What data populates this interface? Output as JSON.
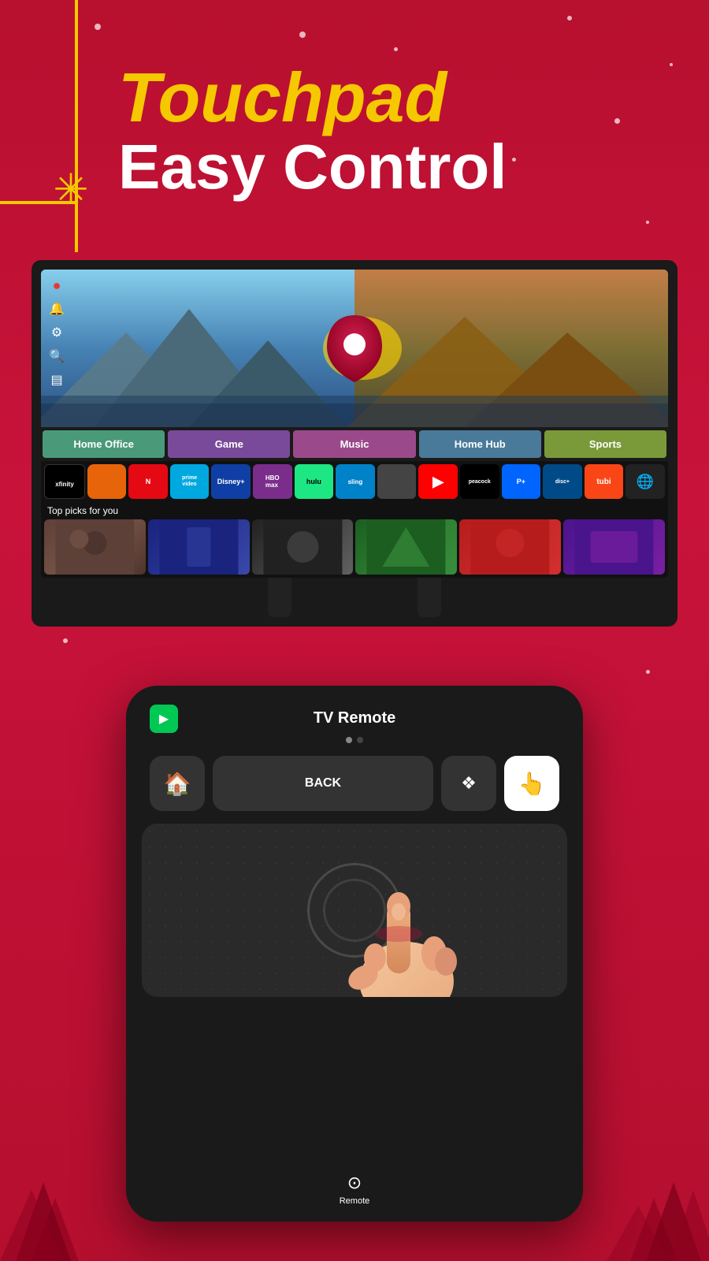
{
  "page": {
    "background_color": "#c0103a"
  },
  "header": {
    "title_line1": "Touchpad",
    "title_line2": "Easy Control"
  },
  "tv": {
    "nav_tabs": [
      {
        "label": "Home Office",
        "class": "home-office"
      },
      {
        "label": "Game",
        "class": "game"
      },
      {
        "label": "Music",
        "class": "music"
      },
      {
        "label": "Home Hub",
        "class": "home-hub"
      },
      {
        "label": "Sports",
        "class": "sports"
      }
    ],
    "apps": [
      {
        "label": "xfinity",
        "class": "app-xfinity"
      },
      {
        "label": "●",
        "class": "app-orange"
      },
      {
        "label": "NETFLIX",
        "class": "app-netflix"
      },
      {
        "label": "prime",
        "class": "app-prime"
      },
      {
        "label": "disney+",
        "class": "app-disney"
      },
      {
        "label": "HBO",
        "class": "app-hbo"
      },
      {
        "label": "hulu",
        "class": "app-hulu"
      },
      {
        "label": "sling",
        "class": "app-sling"
      },
      {
        "label": "🍎",
        "class": "app-apple"
      },
      {
        "label": "▶",
        "class": "app-youtube"
      },
      {
        "label": "peacock",
        "class": "app-peacock"
      },
      {
        "label": "P+",
        "class": "app-paramount"
      },
      {
        "label": "disc+",
        "class": "app-discovery"
      },
      {
        "label": "tubi",
        "class": "app-tubi"
      },
      {
        "label": "🌐",
        "class": "app-globe"
      }
    ],
    "top_picks_label": "Top picks for you"
  },
  "remote": {
    "title": "TV Remote",
    "dots": [
      {
        "active": true
      },
      {
        "active": false
      }
    ],
    "buttons": {
      "home_icon": "🏠",
      "back_label": "BACK",
      "menu_icon": "❖",
      "touchpad_icon": "☞"
    }
  },
  "bottom_nav": {
    "remote_label": "Remote",
    "remote_icon": "⊙"
  }
}
